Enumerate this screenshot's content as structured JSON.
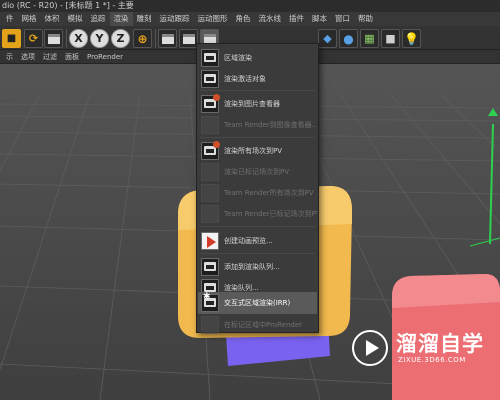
{
  "window": {
    "title": "dio (RC - R20) - [未标题 1 *] - 主要"
  },
  "menubar": {
    "items": [
      "件",
      "网格",
      "体积",
      "模拟",
      "追踪",
      "渲染",
      "雕刻",
      "运动跟踪",
      "运动图形",
      "角色",
      "流水线",
      "插件",
      "脚本",
      "窗口",
      "帮助"
    ]
  },
  "subbar": {
    "items": [
      "示",
      "选项",
      "过滤",
      "面板",
      "ProRender"
    ]
  },
  "toolbar": {
    "axis_x": "X",
    "axis_y": "Y",
    "axis_z": "Z"
  },
  "render_menu": {
    "items": [
      {
        "label": "区域渲染",
        "enabled": true,
        "icon": "render-region-icon"
      },
      {
        "label": "渲染激活对象",
        "enabled": true,
        "icon": "render-active-object-icon"
      },
      {
        "label": "渲染到图片查看器",
        "enabled": true,
        "icon": "render-to-picture-viewer-icon"
      },
      {
        "label": "Team Render到图像查看器...",
        "enabled": false,
        "icon": "team-render-icon"
      },
      {
        "label": "渲染所有场次到PV",
        "enabled": true,
        "icon": "render-all-takes-icon"
      },
      {
        "label": "渲染已标记场次到PV",
        "enabled": false,
        "icon": "render-marked-takes-icon"
      },
      {
        "label": "Team Render所有场次到PV",
        "enabled": false,
        "icon": "team-render-all-takes-icon"
      },
      {
        "label": "Team Render已标记场次到PV",
        "enabled": false,
        "icon": "team-render-marked-takes-icon"
      },
      {
        "label": "创建动画预览...",
        "enabled": true,
        "icon": "make-preview-icon"
      },
      {
        "label": "添加到渲染队列...",
        "enabled": true,
        "icon": "add-to-render-queue-icon"
      },
      {
        "label": "渲染队列...",
        "enabled": true,
        "icon": "render-queue-icon"
      },
      {
        "label": "交互式区域渲染(IRR)",
        "enabled": true,
        "highlighted": true,
        "icon": "interactive-render-region-icon"
      },
      {
        "label": "在标记区域中ProRender",
        "enabled": false,
        "icon": "prorender-icon"
      }
    ]
  },
  "watermark": {
    "title": "溜溜自学",
    "subtitle": "ZIXUE.3D66.COM"
  },
  "colors": {
    "accent_orange": "#e2a21a",
    "cube_yellow": "#f2b94e",
    "cube_blue": "#7a62f0",
    "cube_red": "#ec6d72",
    "menu_bg": "#3b3b3b",
    "menu_highlight": "#5a5a5a"
  }
}
